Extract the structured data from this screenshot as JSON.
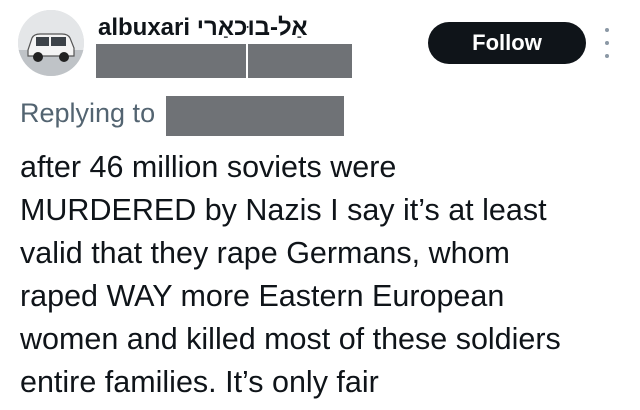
{
  "author": {
    "display_name": "albuxari אַל-בוּכאַרי",
    "avatar_icon": "car-photo-avatar",
    "handle_redacted": true
  },
  "follow_button": {
    "label": "Follow"
  },
  "more_menu": {
    "icon": "more-vertical-icon"
  },
  "reply": {
    "label": "Replying to",
    "target_redacted": true
  },
  "tweet": {
    "lines": [
      "after 46 million soviets were",
      "MURDERED by Nazis I say it’s at least",
      "valid that they rape Germans, whom",
      "raped WAY more Eastern European",
      "women and killed most of these soldiers",
      "entire families. It’s only fair"
    ]
  },
  "colors": {
    "text": "#0f1419",
    "secondary_text": "#536471",
    "button_bg": "#0f1419",
    "redaction": "#6f7276"
  }
}
